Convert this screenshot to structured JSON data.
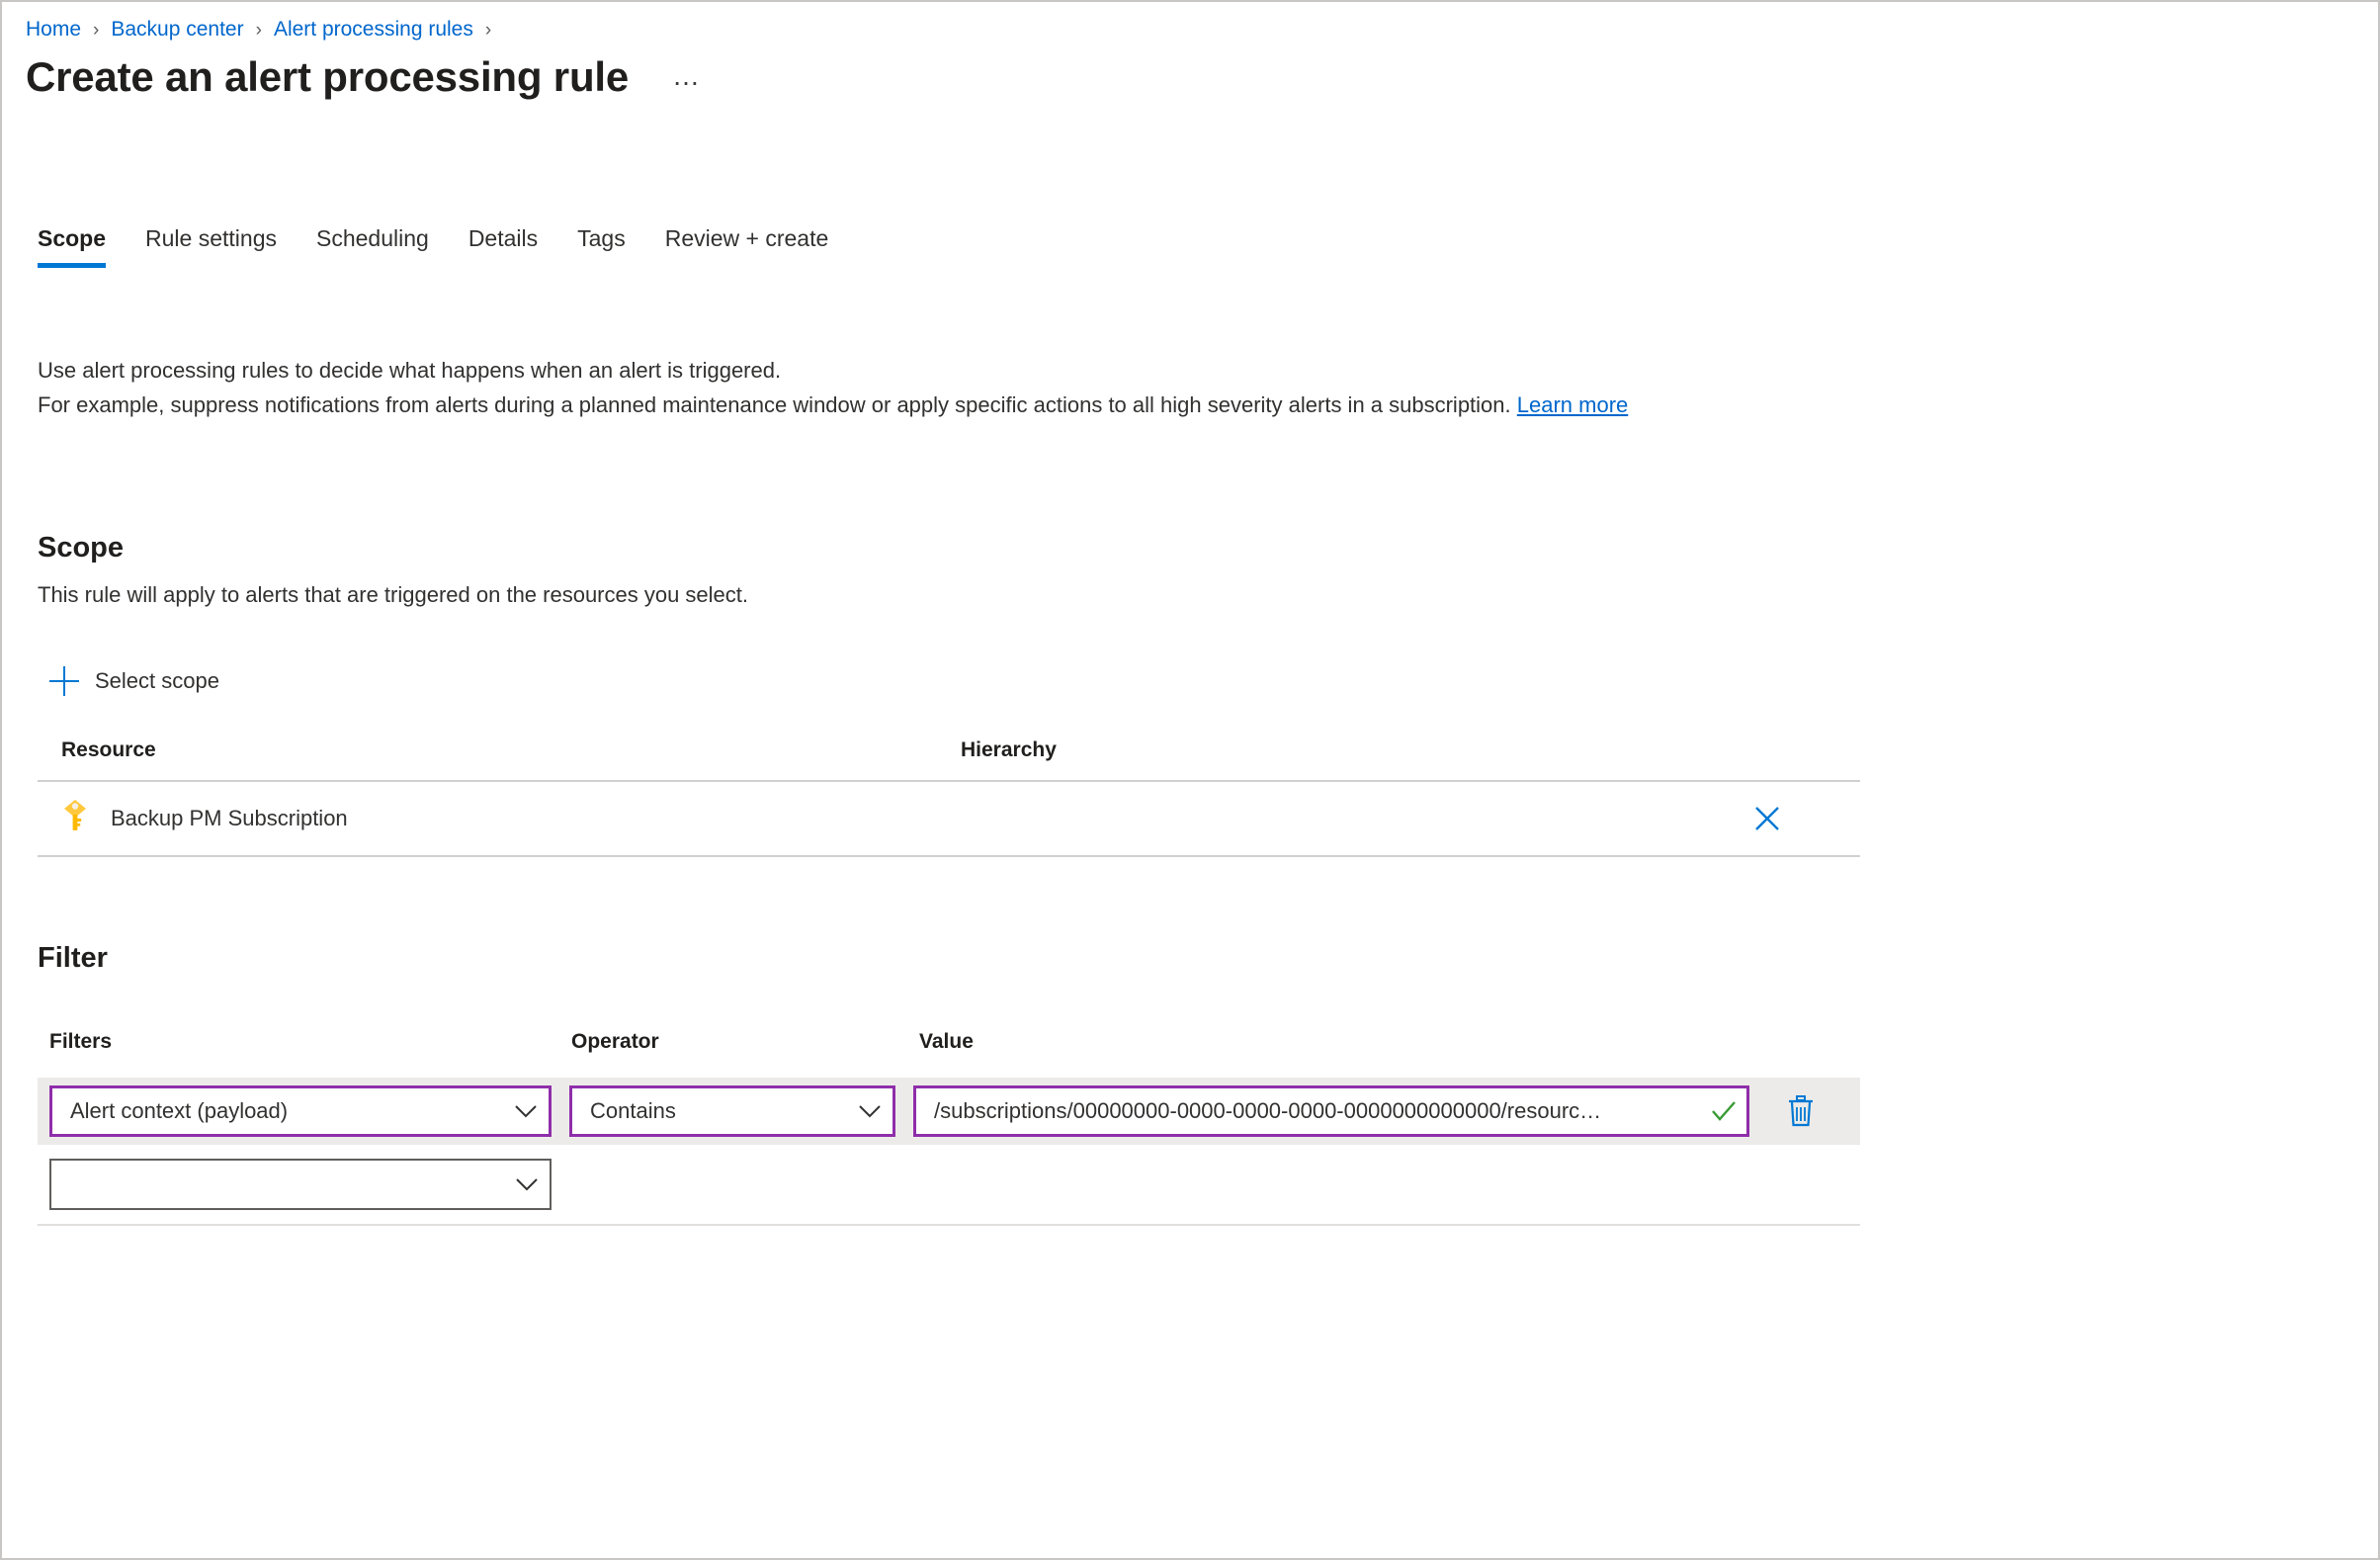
{
  "breadcrumb": {
    "items": [
      {
        "label": "Home"
      },
      {
        "label": "Backup center"
      },
      {
        "label": "Alert processing rules"
      }
    ],
    "separator": "›"
  },
  "header": {
    "title": "Create an alert processing rule",
    "more_menu": "…"
  },
  "tabs": [
    {
      "label": "Scope",
      "selected": true
    },
    {
      "label": "Rule settings",
      "selected": false
    },
    {
      "label": "Scheduling",
      "selected": false
    },
    {
      "label": "Details",
      "selected": false
    },
    {
      "label": "Tags",
      "selected": false
    },
    {
      "label": "Review + create",
      "selected": false
    }
  ],
  "intro": {
    "line1": "Use alert processing rules to decide what happens when an alert is triggered.",
    "line2": "For example, suppress notifications from alerts during a planned maintenance window or apply specific actions to all high severity alerts in a subscription.",
    "link": "Learn more"
  },
  "scope": {
    "heading": "Scope",
    "description": "This rule will apply to alerts that are triggered on the resources you select.",
    "select_scope_label": "Select scope",
    "table": {
      "columns": [
        "Resource",
        "Hierarchy"
      ],
      "rows": [
        {
          "icon": "subscription-key-icon",
          "resource": "Backup PM Subscription",
          "hierarchy": ""
        }
      ]
    }
  },
  "filter": {
    "heading": "Filter",
    "columns": [
      "Filters",
      "Operator",
      "Value"
    ],
    "rows": [
      {
        "filter": "Alert context (payload)",
        "operator": "Contains",
        "value": "/subscriptions/00000000-0000-0000-0000-0000000000000/resourc…",
        "valid": true
      },
      {
        "filter": "",
        "operator": "",
        "value": ""
      }
    ]
  },
  "colors": {
    "link": "#0066cc",
    "accent": "#0078d4",
    "focus_border": "#8f2eaa",
    "key_icon": "#ffb900",
    "valid_check": "#107c10",
    "row_band": "#edebe9",
    "divider": "#d2d0ce"
  }
}
